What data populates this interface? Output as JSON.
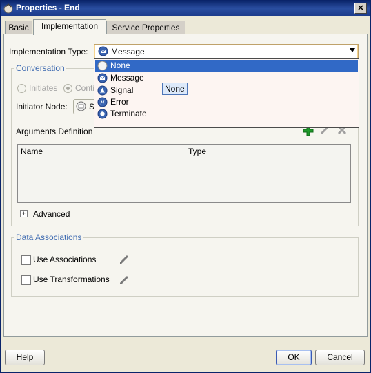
{
  "window": {
    "title": "Properties - End",
    "close": "✕"
  },
  "tabs": {
    "basic": "Basic",
    "implementation": "Implementation",
    "service": "Service Properties"
  },
  "impl": {
    "label": "Implementation Type:",
    "value": "Message"
  },
  "dropdown": {
    "items": [
      {
        "label": "None",
        "icon": "none-event-icon"
      },
      {
        "label": "Message",
        "icon": "message-event-icon"
      },
      {
        "label": "Signal",
        "icon": "signal-event-icon"
      },
      {
        "label": "Error",
        "icon": "error-event-icon"
      },
      {
        "label": "Terminate",
        "icon": "terminate-event-icon"
      }
    ],
    "selected": "None",
    "tooltip": "None"
  },
  "conversation": {
    "title": "Conversation",
    "initiates": "Initiates",
    "continues": "Conti",
    "initiator_label": "Initiator Node:",
    "initiator_value": "S"
  },
  "arguments": {
    "title": "Arguments Definition",
    "col_name": "Name",
    "col_type": "Type"
  },
  "advanced": {
    "label": "Advanced",
    "toggle": "+"
  },
  "data_assoc": {
    "title": "Data Associations",
    "use_assoc": "Use Associations",
    "use_trans": "Use Transformations"
  },
  "buttons": {
    "help": "Help",
    "ok": "OK",
    "cancel": "Cancel"
  },
  "colors": {
    "accent": "#3169c6",
    "title_bar": "#0a246a",
    "group_title": "#3e6ab0",
    "add_green": "#1f9a2a"
  }
}
